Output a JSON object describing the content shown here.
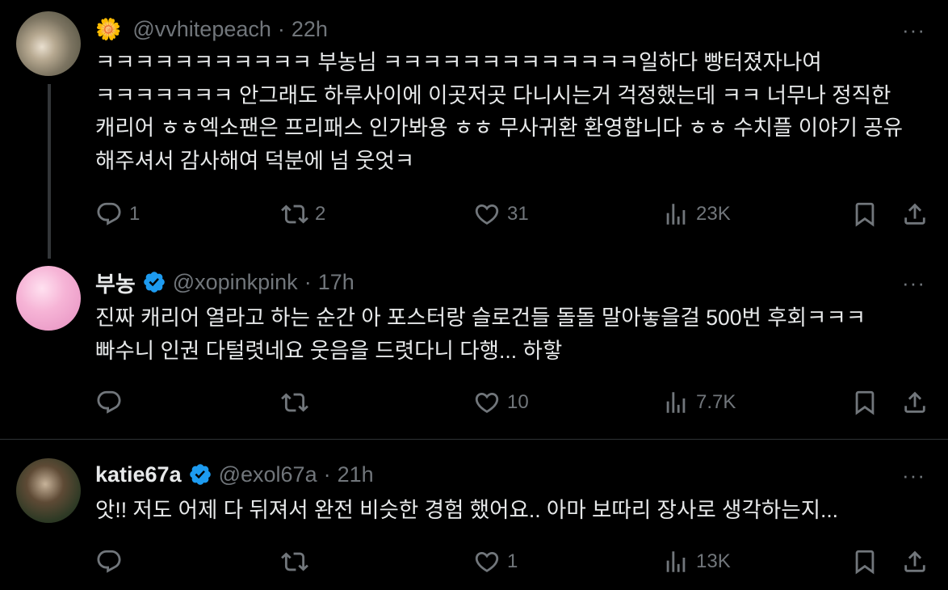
{
  "tweets": [
    {
      "display_name": "",
      "handle": "@vvhitepeach",
      "separator": "·",
      "time": "22h",
      "text": "ㅋㅋㅋㅋㅋㅋㅋㅋㅋㅋㅋ 부농님 ㅋㅋㅋㅋㅋㅋㅋㅋㅋㅋㅋㅋㅋ일하다 빵터졌자나여 ㅋㅋㅋㅋㅋㅋㅋ 안그래도 하루사이에 이곳저곳 다니시는거 걱정했는데 ㅋㅋ 너무나 정직한 캐리어 ㅎㅎ엑소팬은 프리패스 인가봐용 ㅎㅎ 무사귀환 환영합니다 ㅎㅎ 수치플 이야기 공유 해주셔서 감사해여 덕분에 넘 웃엇ㅋ",
      "replies": "1",
      "reposts": "2",
      "likes": "31",
      "views": "23K"
    },
    {
      "display_name": "부농",
      "handle": "@xopinkpink",
      "separator": "·",
      "time": "17h",
      "text": "진짜 캐리어 열라고 하는 순간 아 포스터랑 슬로건들 돌돌 말아놓을걸 500번 후회ㅋㅋㅋ 빠수니 인권 다털렷네요 웃음을 드렷다니 다행... 하핳",
      "replies": "",
      "reposts": "",
      "likes": "10",
      "views": "7.7K"
    },
    {
      "display_name": "katie67a",
      "handle": "@exol67a",
      "separator": "·",
      "time": "21h",
      "text": "앗!! 저도 어제 다 뒤져서 완전 비슷한 경험 했어요.. 아마 보따리 장사로 생각하는지...",
      "replies": "",
      "reposts": "",
      "likes": "1",
      "views": "13K"
    }
  ],
  "icons": {
    "more": "more-icon",
    "reply": "reply-icon",
    "repost": "repost-icon",
    "like": "heart-icon",
    "views": "views-icon",
    "bookmark": "bookmark-icon",
    "share": "share-icon",
    "verified": "verified-badge-icon",
    "flower": "sunflower-emoji-icon"
  },
  "more_label": "···",
  "flower_emoji": "🌼",
  "colors": {
    "background": "#000000",
    "text": "#e7e9ea",
    "secondary": "#71767b",
    "verified": "#1d9bf0",
    "divider": "#2f3336"
  }
}
